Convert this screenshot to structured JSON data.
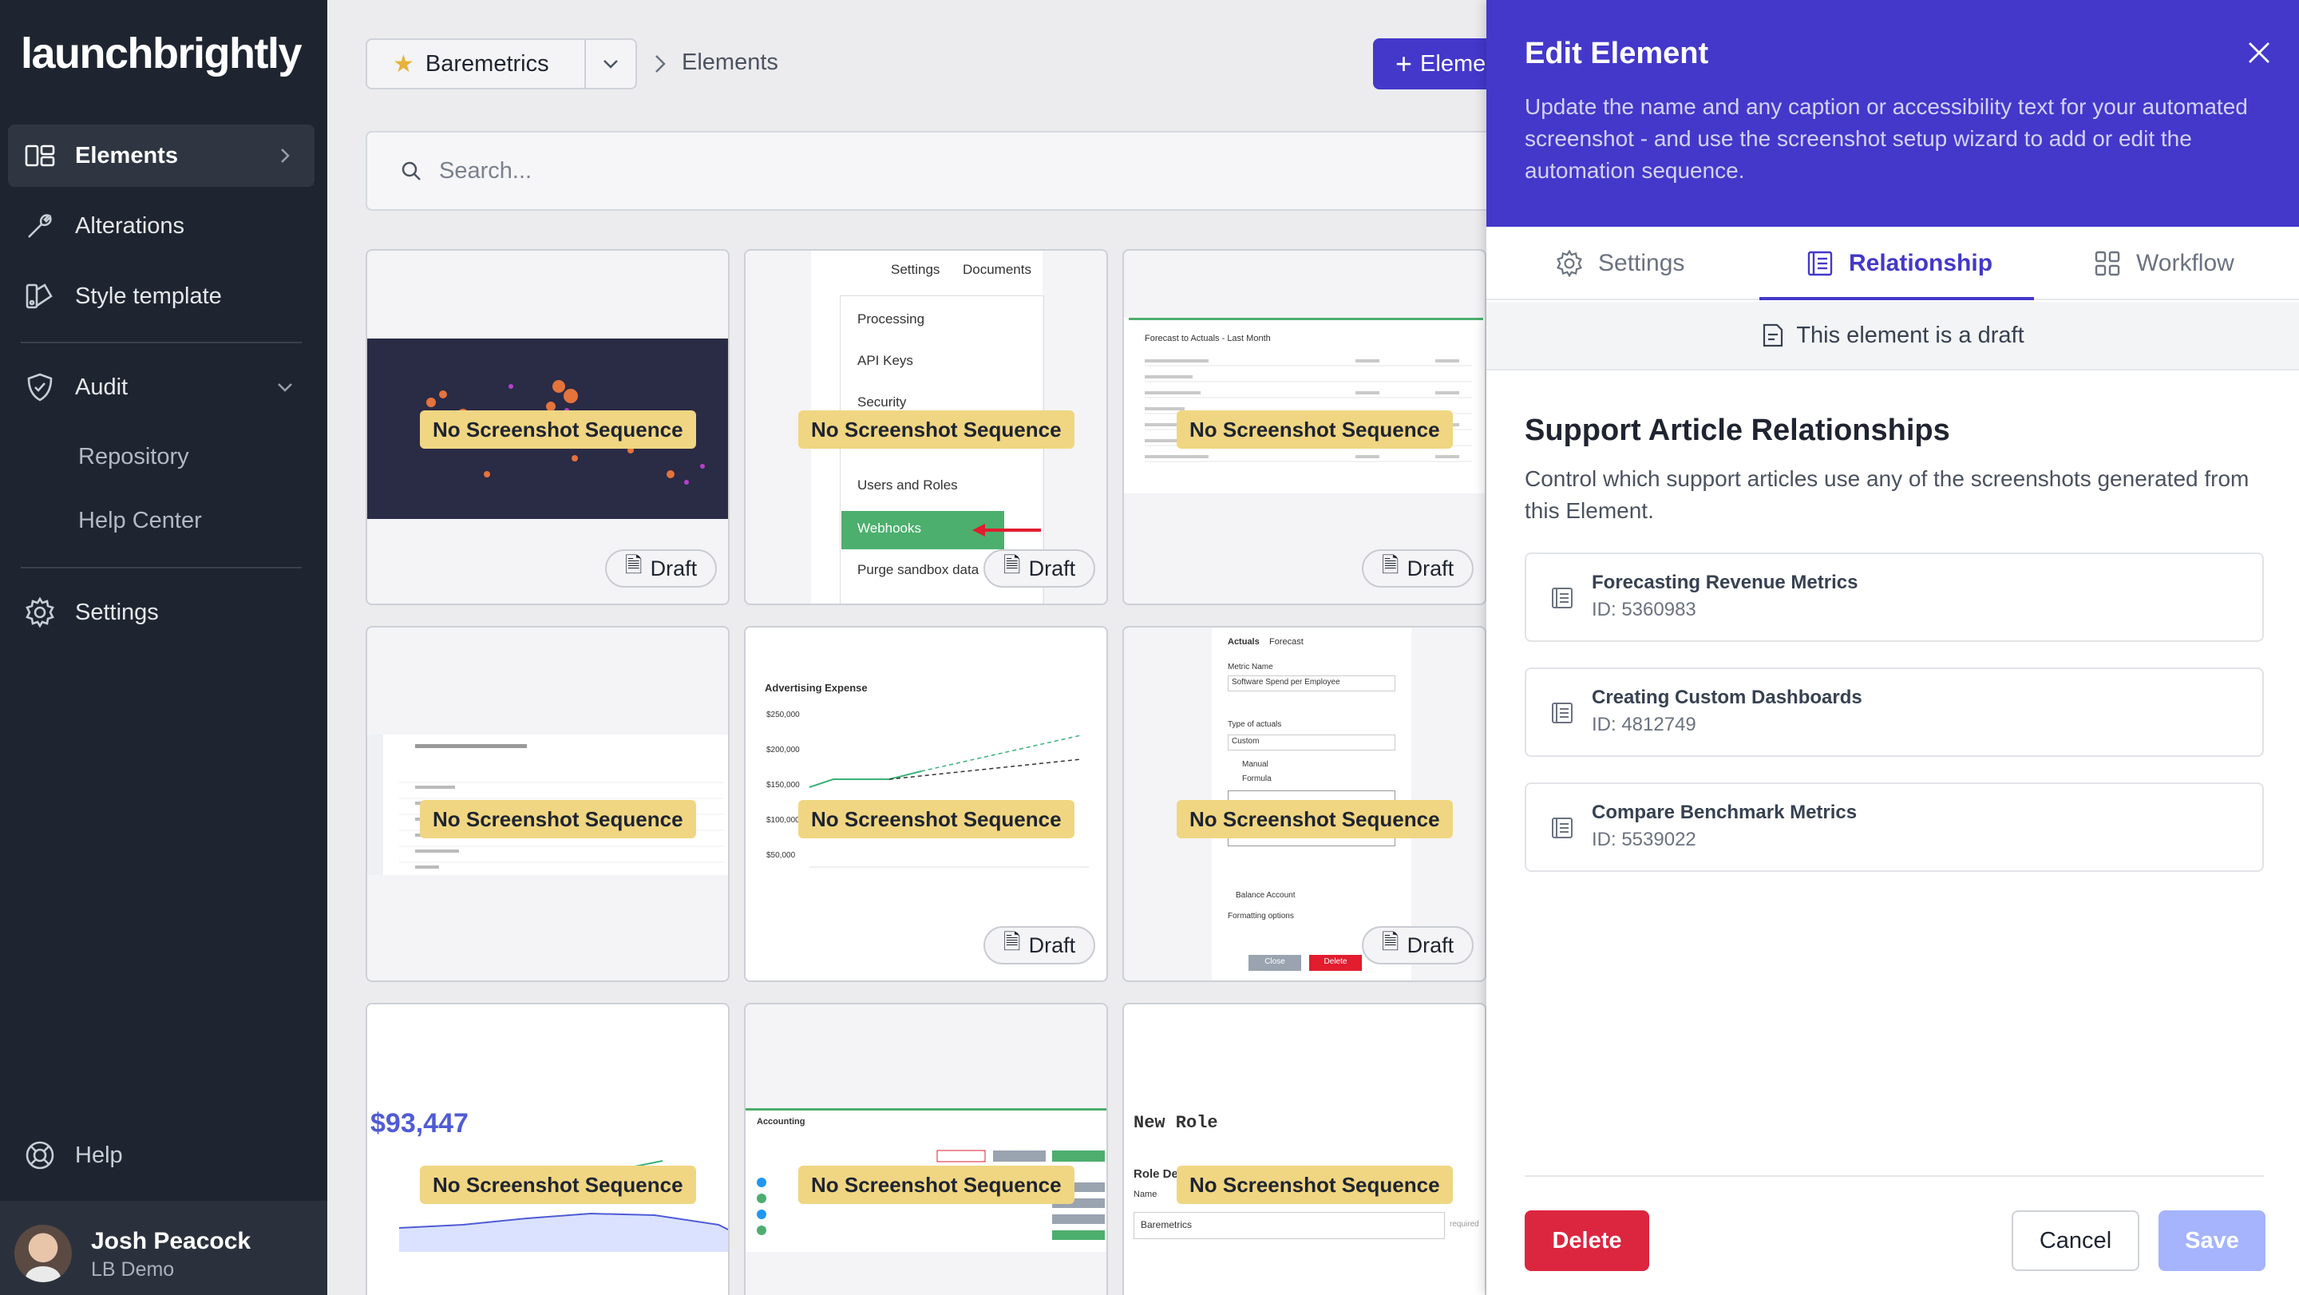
{
  "app": {
    "logo": "launchbrightly"
  },
  "sidebar": {
    "items": [
      {
        "label": "Elements",
        "icon": "elements-icon"
      },
      {
        "label": "Alterations",
        "icon": "wrench-icon"
      },
      {
        "label": "Style template",
        "icon": "style-template-icon"
      },
      {
        "label": "Audit",
        "icon": "shield-icon"
      },
      {
        "label": "Settings",
        "icon": "gear-icon"
      }
    ],
    "audit_sub": [
      "Repository",
      "Help Center"
    ],
    "help": "Help",
    "user": {
      "name": "Josh Peacock",
      "org": "LB Demo"
    }
  },
  "header": {
    "project": "Baremetrics",
    "breadcrumb": "Elements",
    "add_button": "Eleme"
  },
  "search": {
    "placeholder": "Search..."
  },
  "cards": {
    "no_sequence_label": "No Screenshot Sequence",
    "draft_label": "Draft"
  },
  "thumbs": {
    "settings_menu": {
      "tabs": [
        "Settings",
        "Documents"
      ],
      "items": [
        "Processing",
        "API Keys",
        "Security",
        "Users and Roles",
        "Webhooks",
        "Purge sandbox data"
      ]
    },
    "forecast_title": "Forecast to Actuals - Last Month",
    "advertising": {
      "title": "Advertising Expense",
      "ticks": [
        "$250,000",
        "$200,000",
        "$150,000",
        "$100,000",
        "$50,000"
      ]
    },
    "metric_form": {
      "tabs": [
        "Actuals",
        "Forecast"
      ],
      "metric_label": "Metric Name",
      "metric_value": "Software Spend per Employee",
      "type_label": "Type of actuals",
      "type_value": "Custom",
      "manual": "Manual",
      "formula": "Formula",
      "balance": "Balance Account",
      "formatting": "Formatting options",
      "close": "Close",
      "delete": "Delete"
    },
    "big_number": "$93,447",
    "accounting_title": "Accounting",
    "new_role": {
      "title": "New Role",
      "label": "Role De",
      "name_label": "Name",
      "name_value": "Baremetrics",
      "required": "required"
    }
  },
  "panel": {
    "title": "Edit Element",
    "description": "Update the name and any caption or accessibility text for your automated screenshot - and use the screenshot setup wizard to add or edit the automation sequence.",
    "tabs": [
      "Settings",
      "Relationship",
      "Workflow"
    ],
    "active_tab": "Relationship",
    "draft_notice": "This element is a draft",
    "section_title": "Support Article Relationships",
    "section_desc": "Control which support articles use any of the screenshots generated from this Element.",
    "articles": [
      {
        "name": "Forecasting Revenue Metrics",
        "id": "ID: 5360983"
      },
      {
        "name": "Creating Custom Dashboards",
        "id": "ID: 4812749"
      },
      {
        "name": "Compare Benchmark Metrics",
        "id": "ID: 5539022"
      }
    ],
    "buttons": {
      "delete": "Delete",
      "cancel": "Cancel",
      "save": "Save"
    }
  },
  "colors": {
    "accent": "#4338ca",
    "danger": "#dc2640",
    "sidebar": "#1f2530",
    "badge": "#f0d682"
  }
}
